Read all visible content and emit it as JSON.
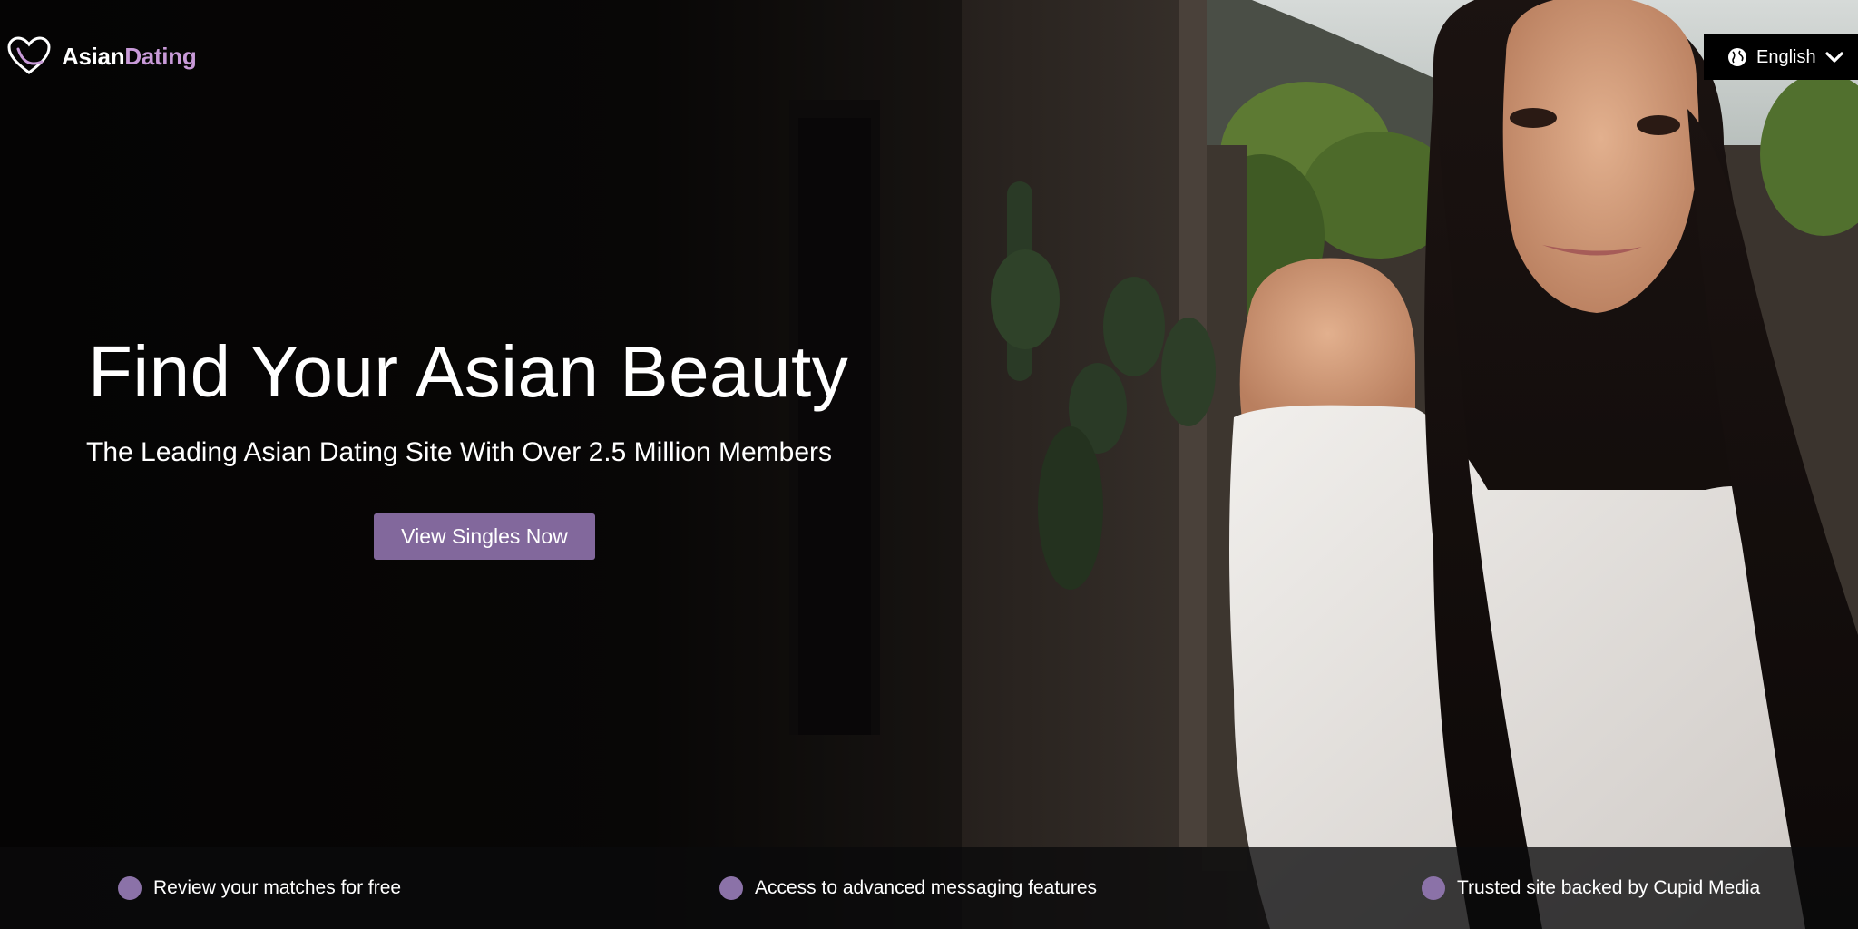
{
  "brand": {
    "name_part1": "Asian",
    "name_part2": "Dating",
    "accent_color": "#c89ad8"
  },
  "header": {
    "language_icon": "globe-icon",
    "language_label": "English",
    "dropdown_icon": "chevron-down-icon"
  },
  "hero": {
    "headline": "Find Your Asian Beauty",
    "subheadline": "The Leading Asian Dating Site With Over 2.5 Million Members",
    "cta_label": "View Singles Now",
    "cta_color": "#82689c"
  },
  "features": {
    "bullet_color": "#8b72a8",
    "items": [
      {
        "label": "Review your matches for free"
      },
      {
        "label": "Access to advanced messaging features"
      },
      {
        "label": "Trusted site backed by Cupid Media"
      }
    ]
  }
}
